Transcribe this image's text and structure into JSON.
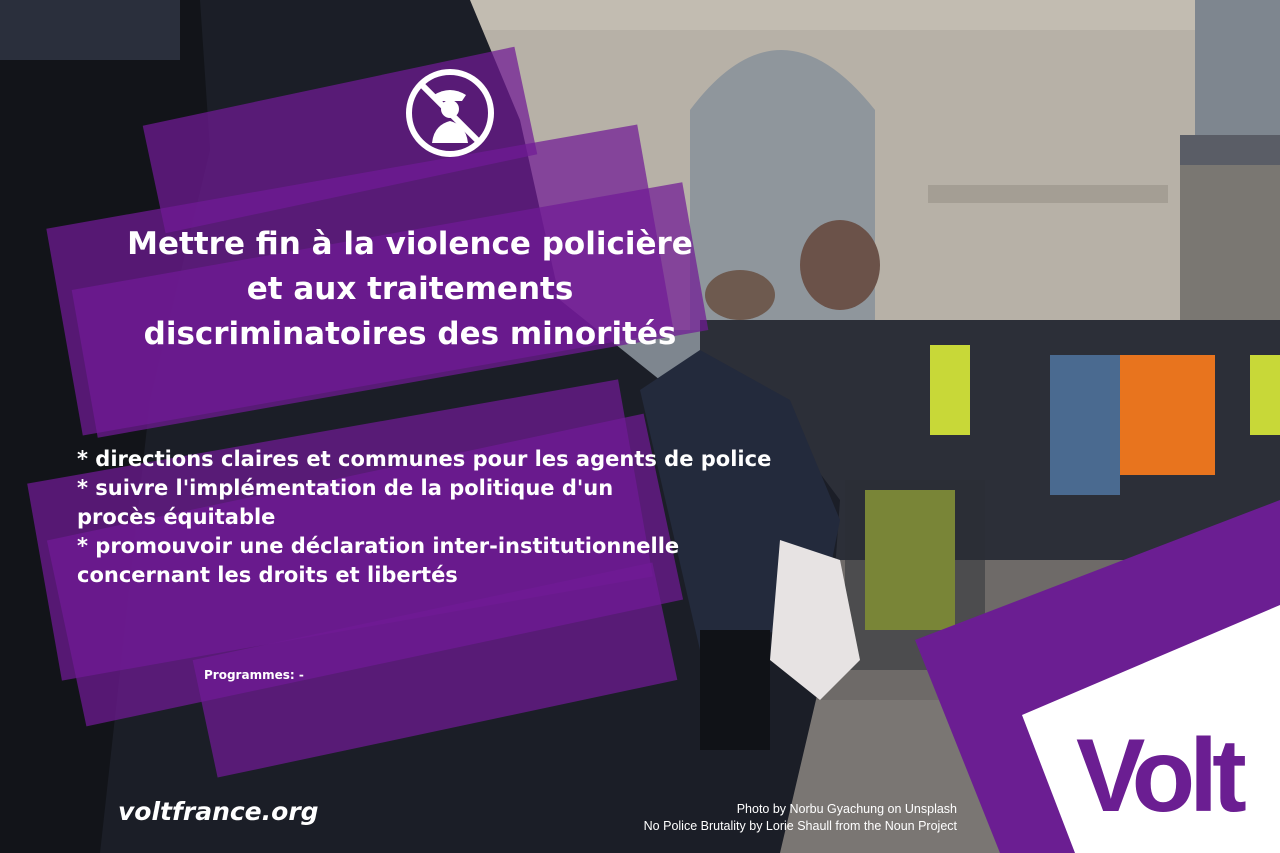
{
  "title_lines": [
    "Mettre fin à la violence policière",
    "et aux traitements",
    "discriminatoires des minorités"
  ],
  "bullets": [
    "* directions claires et communes pour les agents de police",
    "* suivre l'implémentation de la politique d'un",
    "procès équitable",
    "* promouvoir une déclaration inter-institutionnelle",
    "concernant les droits et libertés"
  ],
  "programmes": "Programmes: -",
  "website": "voltfrance.org",
  "credits": [
    "Photo by Norbu Gyachung on Unsplash",
    "No Police Brutality by Lorie Shaull from the Noun Project"
  ],
  "logo_text": "Volt",
  "icon": "no-police-brutality-icon",
  "colors": {
    "brand_purple": "#6b1e92",
    "panel_purple": "#701a96",
    "text": "#ffffff",
    "corner_white": "#ffffff"
  }
}
